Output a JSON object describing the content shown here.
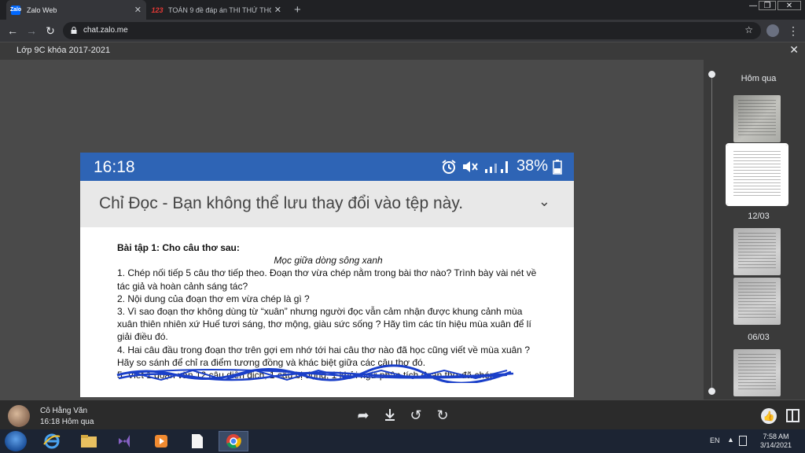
{
  "browser": {
    "tabs": [
      {
        "title": "Zalo Web",
        "favicon": "Zalo"
      },
      {
        "title": "TOÁN 9 đề đáp án THI THỬ THC",
        "favicon": "123"
      }
    ],
    "url": "chat.zalo.me"
  },
  "viewer": {
    "chat_title": "Lớp 9C khóa 2017-2021"
  },
  "image": {
    "status_time": "16:18",
    "battery": "38%",
    "readonly_message": "Chỉ Đọc - Bạn không thể lưu thay đổi vào tệp này.",
    "document": {
      "heading": "Bài tập 1: Cho câu thơ sau:",
      "subtitle": "Mọc giữa dòng sông xanh",
      "lines": [
        "1. Chép nối tiếp 5 câu thơ tiếp theo. Đoạn thơ vừa chép nằm trong bài thơ nào? Trình bày vài nét về tác giả và hoàn cảnh sáng tác?",
        "2. Nội dung của đoạn thơ em vừa chép là gì ?",
        "3. Vì sao đoạn thơ không dùng từ “xuân” nhưng người đọc vẫn cảm nhận được khung cảnh mùa xuân thiên nhiên xứ Huế tươi sáng, thơ mộng, giàu sức sống ? Hãy tìm các tín hiệu mùa xuân để lí giải điều đó.",
        "4. Hai câu đầu trong đoạn thơ trên gợi em nhớ tới hai câu thơ nào đã học cũng viết về mùa xuân ? Hãy so sánh để chỉ ra điểm tương đồng và khác biệt giữa các câu thơ đó."
      ],
      "struck_line": "5. Viết 1 đoạn văn 12 câu diễn dịch, 1 câu bị động, 1 khởi ngữ phân tích đoạn thơ đã chép."
    }
  },
  "rail": {
    "date_labels": [
      "Hôm qua",
      "12/03",
      "06/03"
    ]
  },
  "sender": {
    "name": "Cô Hằng Văn",
    "time": "16:18 Hôm qua"
  },
  "taskbar": {
    "language": "EN",
    "time": "7:58 AM",
    "date": "3/14/2021"
  },
  "colors": {
    "phone_status_bar": "#2e64b5",
    "zalo_brand": "#0068ff",
    "scribble": "#1a3fc9"
  }
}
